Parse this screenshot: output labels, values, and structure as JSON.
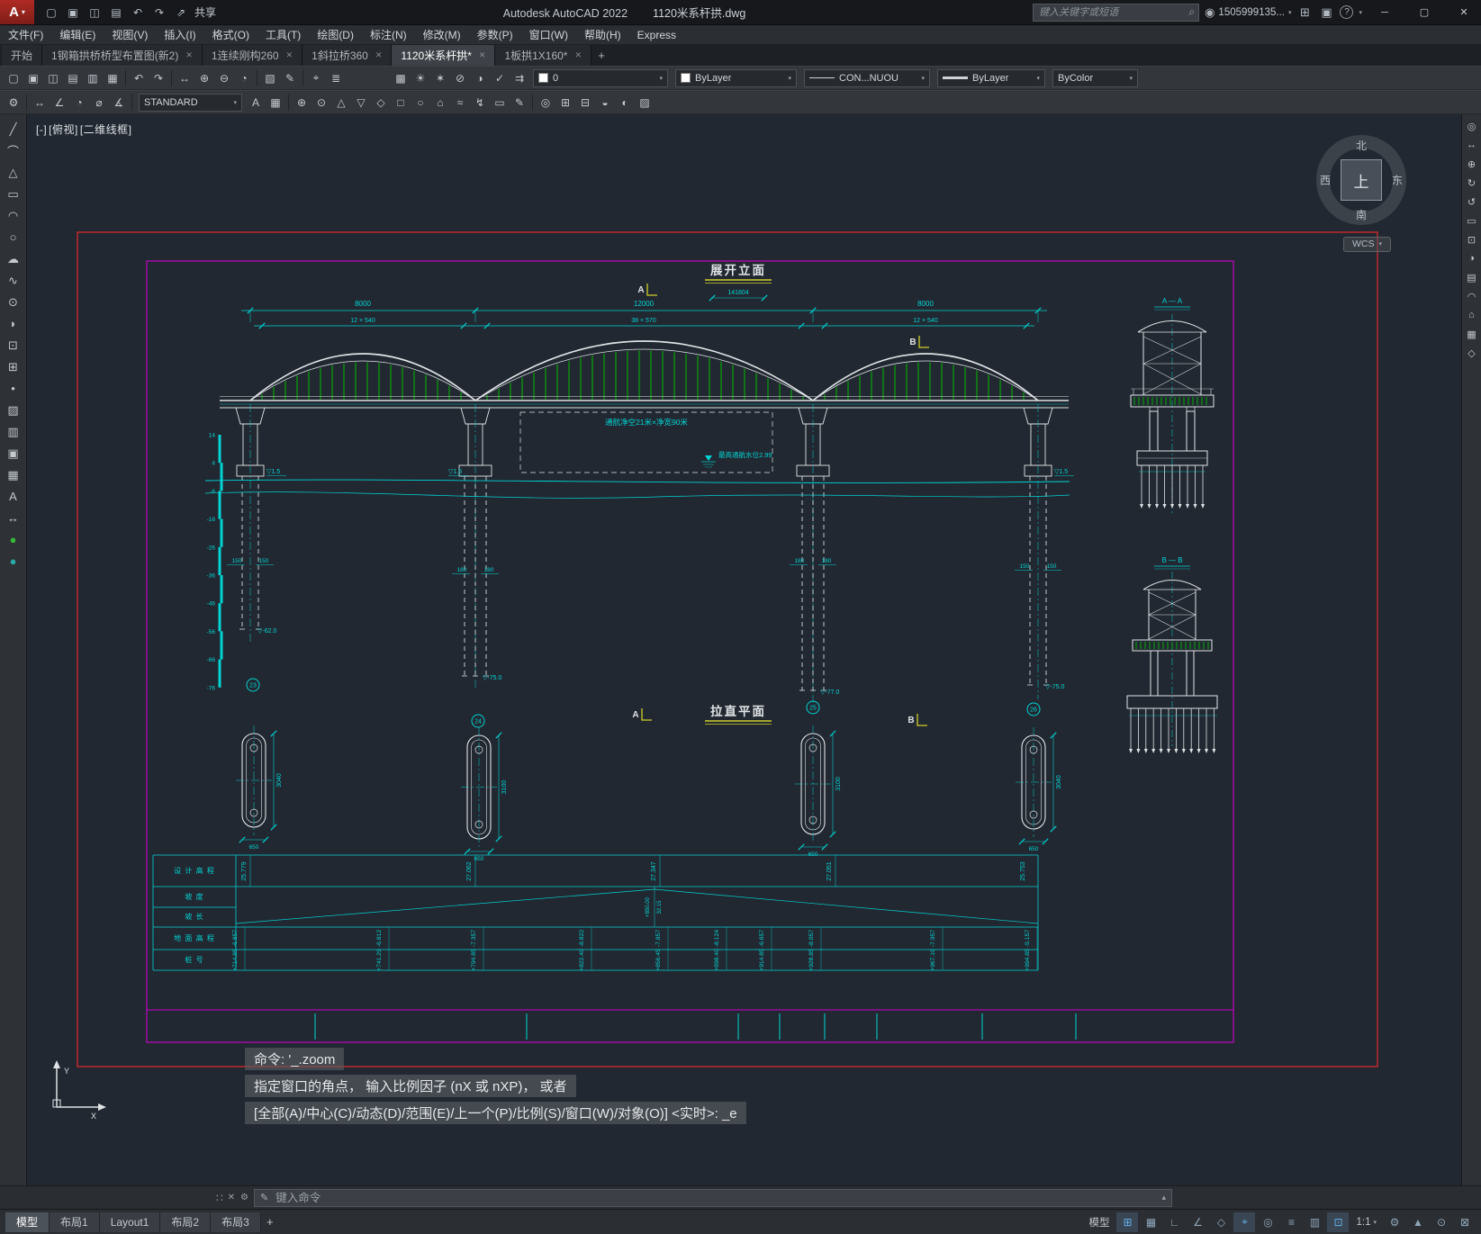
{
  "ui": {
    "close": "✕",
    "dropdown": "▾",
    "plus": "+",
    "minimize": "─",
    "maximize": "▢",
    "window_close": "✕",
    "scroll_up": "▴",
    "search": "⌕",
    "grip": "∷",
    "pencil": "✎",
    "wrench": "⚙"
  },
  "title_bar": {
    "logo": "A",
    "qat": [
      {
        "name": "qat-new-icon",
        "glyph": "▢"
      },
      {
        "name": "qat-open-icon",
        "glyph": "▣"
      },
      {
        "name": "qat-save-icon",
        "glyph": "◫"
      },
      {
        "name": "qat-plot-icon",
        "glyph": "▤"
      },
      {
        "name": "qat-undo-icon",
        "glyph": "↶"
      },
      {
        "name": "qat-redo-icon",
        "glyph": "↷"
      },
      {
        "name": "qat-share-icon",
        "glyph": "⇗"
      }
    ],
    "share_label": "共享",
    "app_name": "Autodesk AutoCAD 2022",
    "doc_name": "1120米系杆拱.dwg",
    "search_placeholder": "键入关键字或短语",
    "account_id": "1505999135...",
    "account_icons": [
      {
        "name": "user-icon",
        "glyph": "◉"
      },
      {
        "name": "cart-icon",
        "glyph": "⊞"
      },
      {
        "name": "apps-icon",
        "glyph": "▣"
      },
      {
        "name": "help-icon",
        "glyph": "?"
      }
    ]
  },
  "menu": {
    "items": [
      "文件(F)",
      "编辑(E)",
      "视图(V)",
      "插入(I)",
      "格式(O)",
      "工具(T)",
      "绘图(D)",
      "标注(N)",
      "修改(M)",
      "参数(P)",
      "窗口(W)",
      "帮助(H)",
      "Express"
    ]
  },
  "file_tabs": {
    "active_index": 4,
    "items": [
      {
        "label": "开始",
        "closable": false
      },
      {
        "label": "1钢箱拱桥桥型布置图(新2)",
        "closable": true
      },
      {
        "label": "1连续刚构260",
        "closable": true
      },
      {
        "label": "1斜拉桥360",
        "closable": true
      },
      {
        "label": "1120米系杆拱*",
        "closable": true
      },
      {
        "label": "1板拱1X160*",
        "closable": true
      }
    ]
  },
  "ribbon1": {
    "icons_left": [
      {
        "name": "new-file-icon",
        "glyph": "▢"
      },
      {
        "name": "open-file-icon",
        "glyph": "▣"
      },
      {
        "name": "save-icon",
        "glyph": "◫"
      },
      {
        "name": "plot-icon",
        "glyph": "▤"
      },
      {
        "name": "plot-preview-icon",
        "glyph": "▥"
      },
      {
        "name": "publish-icon",
        "glyph": "▦"
      },
      {
        "sep": true
      },
      {
        "name": "undo-icon",
        "glyph": "↶"
      },
      {
        "name": "redo-icon",
        "glyph": "↷"
      },
      {
        "sep": true
      },
      {
        "name": "pan-icon",
        "glyph": "↔"
      },
      {
        "name": "zoom-in-icon",
        "glyph": "⊕"
      },
      {
        "name": "zoom-out-icon",
        "glyph": "⊖"
      },
      {
        "name": "zoom-previous-icon",
        "glyph": "◔"
      },
      {
        "sep": true
      },
      {
        "name": "properties-icon",
        "glyph": "▧"
      },
      {
        "name": "match-properties-icon",
        "glyph": "✎"
      },
      {
        "sep": true
      },
      {
        "name": "measure-icon",
        "glyph": "⌖"
      },
      {
        "name": "list-icon",
        "glyph": "≣"
      }
    ],
    "icons_layer": [
      {
        "name": "layer-properties-icon",
        "glyph": "▩"
      },
      {
        "name": "layer-on-icon",
        "glyph": "☀"
      },
      {
        "name": "layer-freeze-icon",
        "glyph": "✶"
      },
      {
        "name": "layer-lock-icon",
        "glyph": "⊘"
      },
      {
        "name": "layer-isolate-icon",
        "glyph": "◑"
      },
      {
        "name": "set-current-layer-icon",
        "glyph": "✓"
      },
      {
        "name": "match-layer-icon",
        "glyph": "⇉"
      }
    ],
    "layer_value": "0",
    "color_value": "ByLayer",
    "linetype_value": "CON...NUOU",
    "lineweight_value": "ByLayer",
    "plotstyle_value": "ByColor"
  },
  "ribbon2": {
    "icons_a": [
      {
        "name": "workspace-settings-icon",
        "glyph": "⚙"
      },
      {
        "sep": true
      },
      {
        "name": "dim-linear-icon",
        "glyph": "↔"
      },
      {
        "name": "dim-angular-icon",
        "glyph": "∠"
      },
      {
        "name": "dim-radius-icon",
        "glyph": "◔"
      },
      {
        "name": "dim-diameter-icon",
        "glyph": "⌀"
      },
      {
        "name": "dim-arc-icon",
        "glyph": "∡"
      },
      {
        "sep": true
      }
    ],
    "style_value": "STANDARD",
    "icons_b": [
      {
        "name": "text-style-icon",
        "glyph": "A"
      },
      {
        "name": "table-style-icon",
        "glyph": "▦"
      },
      {
        "sep": true
      }
    ],
    "icons_c": [
      {
        "name": "multileader-icon",
        "glyph": "⊕"
      },
      {
        "name": "center-mark-icon",
        "glyph": "⊙"
      },
      {
        "name": "tolerance-icon",
        "glyph": "△"
      },
      {
        "name": "datum-icon",
        "glyph": "▽"
      },
      {
        "name": "block-icon",
        "glyph": "◇"
      },
      {
        "name": "region-icon",
        "glyph": "□"
      },
      {
        "name": "donut-icon",
        "glyph": "○"
      },
      {
        "name": "base-icon",
        "glyph": "⌂"
      },
      {
        "name": "spline-edit-icon",
        "glyph": "≈"
      },
      {
        "name": "quick-dim-icon",
        "glyph": "↯"
      },
      {
        "name": "viewport-icon",
        "glyph": "▭"
      },
      {
        "name": "edit-text-icon",
        "glyph": "✎"
      },
      {
        "sep": true
      },
      {
        "name": "group-icon",
        "glyph": "◎"
      },
      {
        "name": "array-icon",
        "glyph": "⊞"
      },
      {
        "name": "ungroup-icon",
        "glyph": "⊟"
      },
      {
        "name": "shade-icon",
        "glyph": "◒"
      },
      {
        "name": "visual-style-icon",
        "glyph": "◐"
      },
      {
        "name": "hatch-edit-icon",
        "glyph": "▨"
      }
    ]
  },
  "left_palette": {
    "tools": [
      {
        "name": "line-tool",
        "glyph": "╱"
      },
      {
        "name": "polyline-tool",
        "glyph": "⌒"
      },
      {
        "name": "polygon-tool",
        "glyph": "△"
      },
      {
        "name": "rectangle-tool",
        "glyph": "▭"
      },
      {
        "name": "arc-tool",
        "glyph": "◠"
      },
      {
        "name": "circle-tool",
        "glyph": "○"
      },
      {
        "name": "revcloud-tool",
        "glyph": "☁"
      },
      {
        "name": "spline-tool",
        "glyph": "∿"
      },
      {
        "name": "ellipse-tool",
        "glyph": "⊙"
      },
      {
        "name": "ellipse-arc-tool",
        "glyph": "◗"
      },
      {
        "name": "insert-block-tool",
        "glyph": "⊡"
      },
      {
        "name": "create-block-tool",
        "glyph": "⊞"
      },
      {
        "name": "point-tool",
        "glyph": "•"
      },
      {
        "name": "hatch-tool",
        "glyph": "▨"
      },
      {
        "name": "gradient-tool",
        "glyph": "▥"
      },
      {
        "name": "region-tool",
        "glyph": "▣"
      },
      {
        "name": "table-tool",
        "glyph": "▦"
      },
      {
        "name": "mtext-tool",
        "glyph": "A"
      },
      {
        "name": "dimension-tool",
        "glyph": "↔"
      },
      {
        "name": "color-green-dot",
        "glyph": "●",
        "color": "#37b837"
      },
      {
        "name": "color-teal-dot",
        "glyph": "●",
        "color": "#2aa8a8"
      }
    ]
  },
  "right_palette": {
    "tools": [
      {
        "name": "steering-wheel-icon",
        "glyph": "◎"
      },
      {
        "name": "pan-hand-icon",
        "glyph": "↔"
      },
      {
        "name": "zoom-extents-icon",
        "glyph": "⊕"
      },
      {
        "name": "orbit-icon",
        "glyph": "↻"
      },
      {
        "name": "orbit-free-icon",
        "glyph": "↺"
      },
      {
        "name": "show-motion-icon",
        "glyph": "▭"
      },
      {
        "name": "isolate-objects-icon",
        "glyph": "⊡"
      },
      {
        "name": "shadow-icon",
        "glyph": "◑"
      },
      {
        "name": "sheet-set-icon",
        "glyph": "▤"
      },
      {
        "name": "arc-measure-icon",
        "glyph": "◠"
      },
      {
        "name": "home-view-icon",
        "glyph": "⌂"
      },
      {
        "name": "grid-display-icon",
        "glyph": "▦"
      },
      {
        "name": "wireframe-icon",
        "glyph": "◇"
      }
    ]
  },
  "viewport": {
    "controls": [
      "[-]",
      "[俯视]",
      "[二维线框]"
    ],
    "wcs": "WCS",
    "navcube": {
      "n": "北",
      "s": "南",
      "w": "西",
      "e": "东",
      "top": "上"
    }
  },
  "drawing": {
    "colors": {
      "cyan": "#00d4d4",
      "green": "#00bb00",
      "white": "#dfe3e6",
      "red": "#d42a2a",
      "magenta": "#cf00cf",
      "yellow": "#cfcf2a"
    },
    "elevation_view": {
      "title": "展开立面",
      "drawing_no": "141804",
      "section_marker_a": "A",
      "section_marker_b": "B",
      "main_dims": [
        "8000",
        "12000",
        "8000"
      ],
      "sub_dims": [
        "12 × 540",
        "38 × 570",
        "12 × 540"
      ],
      "nav_clearance": "通航净空21米×净宽90米",
      "high_water": "最高通航水位2.99",
      "bearing_levels": [
        "▽1.5",
        "▽1.5",
        "▽1.5"
      ],
      "ruler_labels": [
        "14",
        "4",
        "-6",
        "-16",
        "-26",
        "-36",
        "-46",
        "-56",
        "-66",
        "-76"
      ],
      "pile_dia_labels": [
        [
          "150",
          "150"
        ],
        [
          "180",
          "180"
        ],
        [
          "180",
          "180"
        ],
        [
          "150",
          "150"
        ]
      ],
      "pile_tip_levels": [
        "▽-62.0",
        "▽-75.0",
        "▽-77.0",
        "▽-75.0"
      ],
      "pier_numbers": [
        "23",
        "24",
        "25",
        "26"
      ]
    },
    "plan_view": {
      "title": "拉直平面",
      "marker_a": "A",
      "marker_b": "B",
      "cap_lengths": [
        "3040",
        "3100",
        "3100",
        "3040"
      ],
      "cap_width": "650"
    },
    "sections": {
      "a": "A — A",
      "b": "B — B"
    },
    "ucs": {
      "x": "X",
      "y": "Y"
    },
    "table": {
      "row_labels": [
        "设 计 高 程",
        "坡   度",
        "坡   长",
        "地 面 高 程",
        "桩   号"
      ],
      "design_elevations": [
        "25.779",
        "27.062",
        "27.347",
        "27.051",
        "25.753"
      ],
      "slope_labels": [
        "+850.00",
        "32.15"
      ],
      "ground_elevations": [
        "-6.857",
        "-6.812",
        "-7.357",
        "-8.822",
        "-7.857",
        "-8.124",
        "-6.657",
        "-8.057",
        "-7.957",
        "-5.157"
      ],
      "stations": [
        "+714.85",
        "+741.29",
        "+794.85",
        "+822.40",
        "+856.45",
        "+898.40",
        "+914.85",
        "+928.85",
        "+967.10",
        "+994.85"
      ]
    }
  },
  "command": {
    "history": [
      "命令: '_.zoom",
      "指定窗口的角点， 输入比例因子 (nX 或 nXP)， 或者",
      "[全部(A)/中心(C)/动态(D)/范围(E)/上一个(P)/比例(S)/窗口(W)/对象(O)] <实时>: _e"
    ],
    "input_placeholder": "键入命令"
  },
  "layout_tabs": {
    "active_index": 0,
    "items": [
      "模型",
      "布局1",
      "Layout1",
      "布局2",
      "布局3"
    ]
  },
  "status_bar": {
    "items": [
      {
        "name": "model-space-toggle",
        "label": "模型"
      },
      {
        "name": "grid-icon",
        "glyph": "⊞",
        "active": true
      },
      {
        "name": "snap-icon",
        "glyph": "▦"
      },
      {
        "name": "ortho-icon",
        "glyph": "∟"
      },
      {
        "name": "polar-tracking-icon",
        "glyph": "∠"
      },
      {
        "name": "isodraft-icon",
        "glyph": "◇"
      },
      {
        "name": "osnap-icon",
        "glyph": "⌖",
        "active": true
      },
      {
        "name": "otrack-icon",
        "glyph": "◎"
      },
      {
        "name": "lineweight-icon",
        "glyph": "≡"
      },
      {
        "name": "transparency-icon",
        "glyph": "▥"
      },
      {
        "name": "selection-cycling-icon",
        "glyph": "⊡",
        "active": true
      },
      {
        "name": "annotation-scale",
        "label": "1:1",
        "arrow": true
      },
      {
        "name": "workspace-icon",
        "glyph": "⚙",
        "arrow": true
      },
      {
        "name": "annotation-visibility-icon",
        "glyph": "▲"
      },
      {
        "name": "isolate-icon",
        "glyph": "⊙"
      },
      {
        "name": "clean-screen-icon",
        "glyph": "⊠"
      }
    ]
  }
}
